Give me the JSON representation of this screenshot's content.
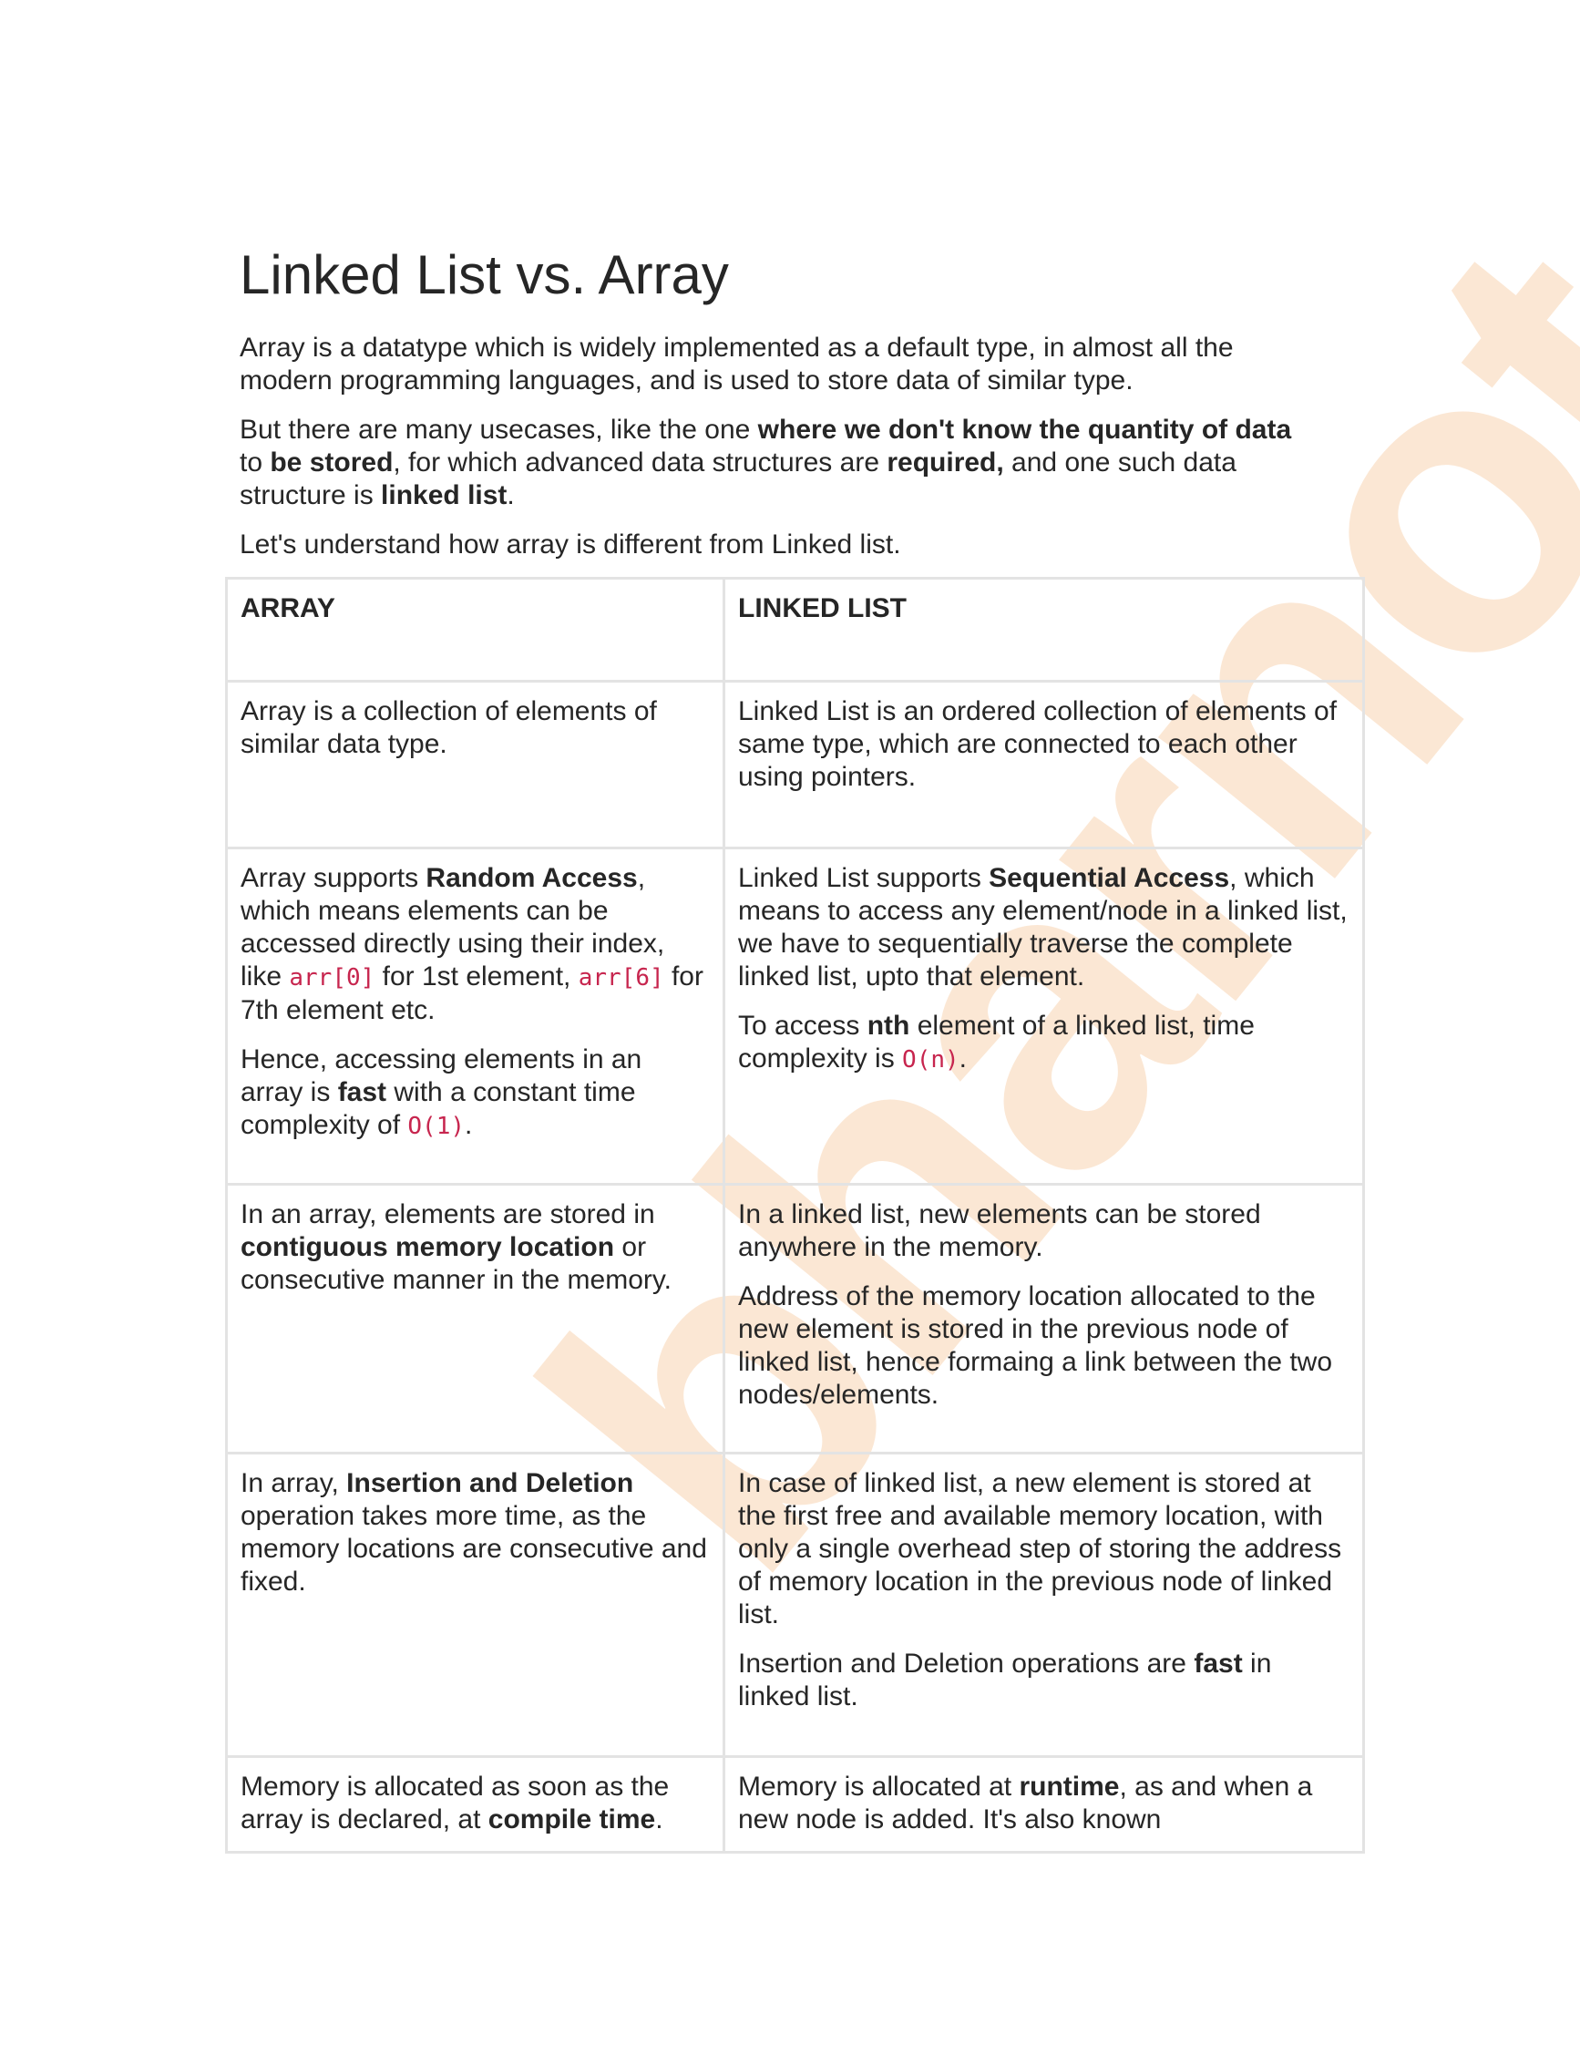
{
  "title": "Linked List vs. Array",
  "intro": {
    "p1": "Array is a datatype which is widely implemented as a default type, in almost all the modern programming languages, and is used to store data of similar type.",
    "p2": {
      "t1": "But there are many usecases, like the one ",
      "b1": "where we don't know the quantity of data",
      "t2": " to ",
      "b2": "be stored",
      "t3": ", for which advanced data structures are ",
      "b3": "required,",
      "t4": " and one such data structure is ",
      "b4": "linked list",
      "t5": "."
    },
    "p3": "Let's understand how array is different from Linked list."
  },
  "table": {
    "headers": [
      "ARRAY",
      "LINKED LIST"
    ],
    "row1": {
      "array": "Array is a collection of elements of similar data type.",
      "linked": "Linked List is an ordered collection of elements of same type, which are connected to each other using pointers."
    },
    "row2": {
      "array_p1": {
        "t1": "Array supports ",
        "b1": "Random Access",
        "t2": ", which means elements can be accessed directly using their index, like ",
        "c1": "arr[0]",
        "t3": " for 1st element, ",
        "c2": "arr[6]",
        "t4": " for 7th element etc."
      },
      "array_p2": {
        "t1": "Hence, accessing elements in an array is ",
        "b1": "fast",
        "t2": " with a constant time complexity of ",
        "c1": "O(1)",
        "t3": "."
      },
      "linked_p1": {
        "t1": "Linked List supports ",
        "b1": "Sequential Access",
        "t2": ", which means to access any element/node in a linked list, we have to sequentially traverse the complete linked list, upto that element."
      },
      "linked_p2": {
        "t1": "To access ",
        "b1": "nth",
        "t2": " element of a linked list, time complexity is ",
        "c1": "O(n)",
        "t3": "."
      }
    },
    "row3": {
      "array": {
        "t1": "In an array, elements are stored in ",
        "b1": "contiguous memory location",
        "t2": " or consecutive manner in the memory."
      },
      "linked_p1": "In a linked list, new elements can be stored anywhere in the memory.",
      "linked_p2": "Address of the memory location allocated to the new element is stored in the previous node of linked list, hence formaing a link between the two nodes/elements."
    },
    "row4": {
      "array": {
        "t1": "In array, ",
        "b1": "Insertion and Deletion",
        "t2": " operation takes more time, as the memory locations are consecutive and fixed."
      },
      "linked_p1": "In case of linked list, a new element is stored at the first free and available memory location, with only a single overhead step of storing the address of memory location in the previous node of linked list.",
      "linked_p2": {
        "t1": "Insertion and Deletion operations are ",
        "b1": "fast",
        "t2": " in linked list."
      }
    },
    "row5": {
      "array": {
        "t1": "Memory is allocated as soon as the array is declared, at ",
        "b1": "compile time",
        "t2": "."
      },
      "linked": {
        "t1": "Memory is allocated at ",
        "b1": "runtime",
        "t2": ", as and when a new node is added. It's also known"
      }
    }
  },
  "watermark": "bharnotes",
  "colors": {
    "text": "#262626",
    "code": "#c7254e",
    "border": "#e3e3e3",
    "watermark": "#f7c79a"
  }
}
